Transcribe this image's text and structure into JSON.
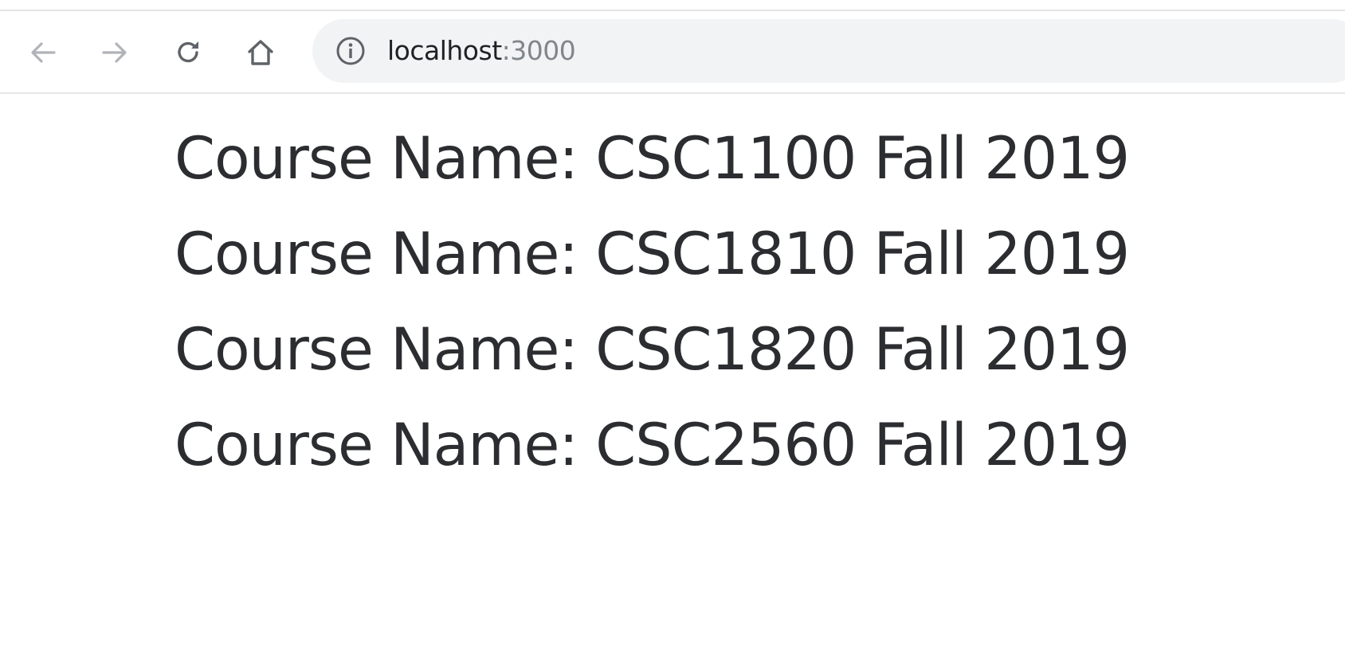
{
  "browser": {
    "nav": {
      "back_icon": "arrow-left-icon",
      "forward_icon": "arrow-right-icon",
      "reload_icon": "reload-icon",
      "home_icon": "home-icon"
    },
    "address_bar": {
      "security_icon": "info-icon",
      "host": "localhost",
      "port_suffix": ":3000"
    }
  },
  "page": {
    "courses": [
      "Course Name: CSC1100 Fall 2019",
      "Course Name: CSC1810 Fall 2019",
      "Course Name: CSC1820 Fall 2019",
      "Course Name: CSC2560 Fall 2019"
    ]
  }
}
